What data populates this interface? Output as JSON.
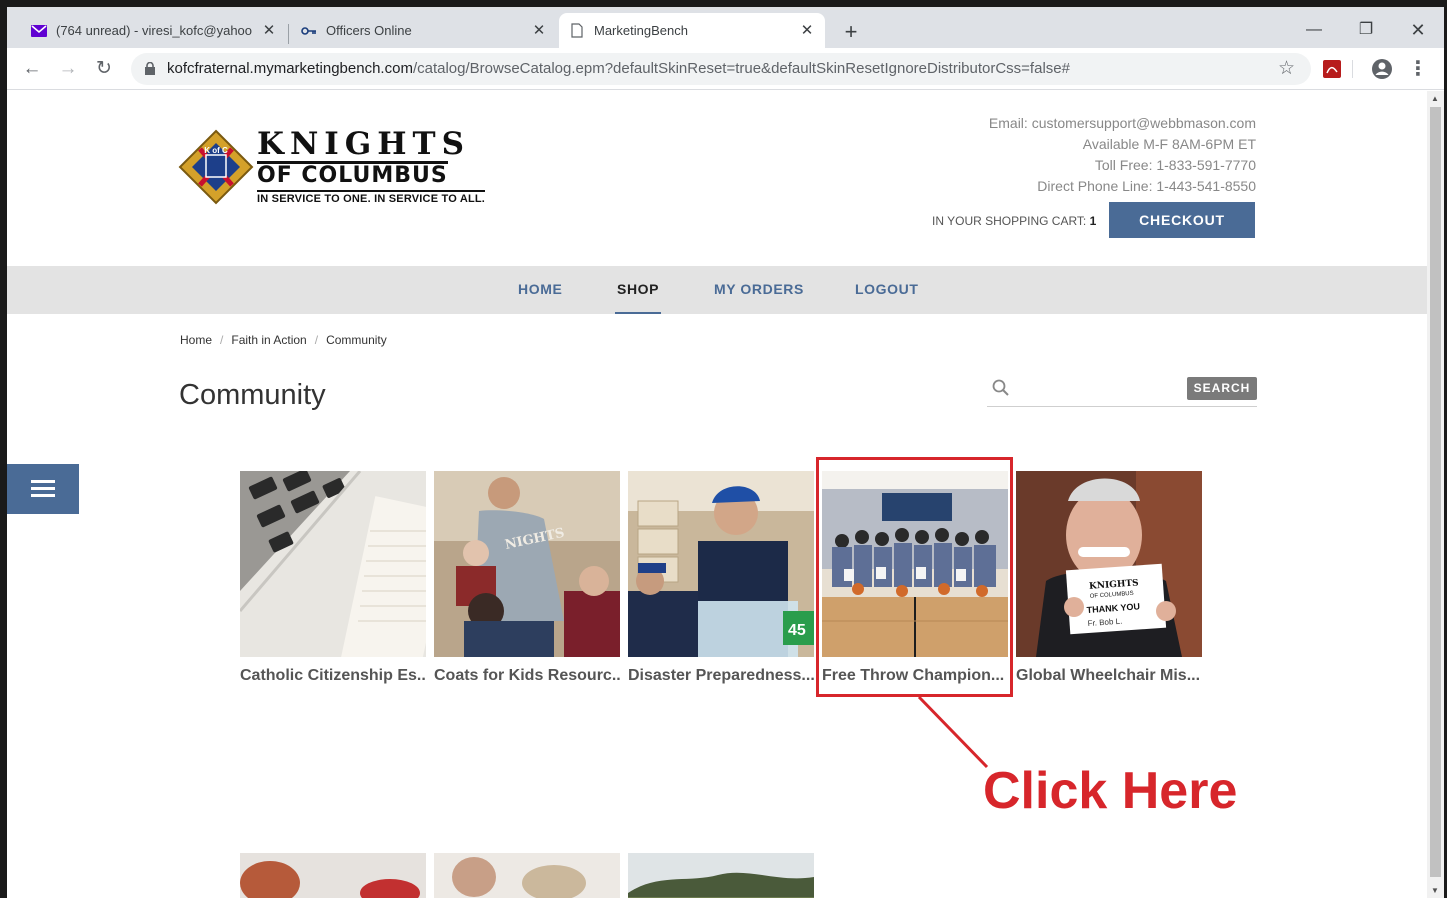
{
  "browser": {
    "tabs": [
      {
        "label": "(764 unread) - viresi_kofc@yahoo",
        "icon": "mail-icon",
        "active": false
      },
      {
        "label": "Officers Online",
        "icon": "key-icon",
        "active": false
      },
      {
        "label": "MarketingBench",
        "icon": "page-icon",
        "active": true
      }
    ],
    "new_tab_label": "+",
    "url_host": "kofcfraternal.mymarketingbench.com",
    "url_path": "/catalog/BrowseCatalog.epm?defaultSkinReset=true&defaultSkinResetIgnoreDistributorCss=false#"
  },
  "header": {
    "logo": {
      "line1": "KNIGHTS",
      "line2": "OF COLUMBUS",
      "line3": "IN SERVICE TO ONE. IN SERVICE TO ALL.",
      "badge_text": "K of C"
    },
    "email_line": "Email:  customersupport@webbmason.com",
    "hours_line": "Available M-F 8AM-6PM ET",
    "tollfree_line": "Toll Free: 1-833-591-7770",
    "direct_line": "Direct Phone Line: 1-443-541-8550",
    "cart_label": "IN YOUR SHOPPING CART:",
    "cart_count": "1",
    "checkout_label": "CHECKOUT"
  },
  "nav": {
    "items": [
      {
        "label": "HOME"
      },
      {
        "label": "SHOP"
      },
      {
        "label": "MY ORDERS"
      },
      {
        "label": "LOGOUT"
      }
    ],
    "active": "SHOP"
  },
  "breadcrumb": [
    "Home",
    "Faith in Action",
    "Community"
  ],
  "page_title": "Community",
  "search": {
    "placeholder": "",
    "button_label": "SEARCH"
  },
  "products": [
    {
      "name": "Catholic Citizenship Es..."
    },
    {
      "name": "Coats for Kids Resourc..."
    },
    {
      "name": "Disaster Preparedness..."
    },
    {
      "name": "Free Throw Champion..."
    },
    {
      "name": "Global Wheelchair Mis..."
    }
  ],
  "annotation": {
    "text": "Click Here",
    "color": "#d7262b"
  },
  "colors": {
    "accent": "#4a6b96",
    "nav_bg": "#e3e3e3",
    "annotation_red": "#d7262b"
  }
}
